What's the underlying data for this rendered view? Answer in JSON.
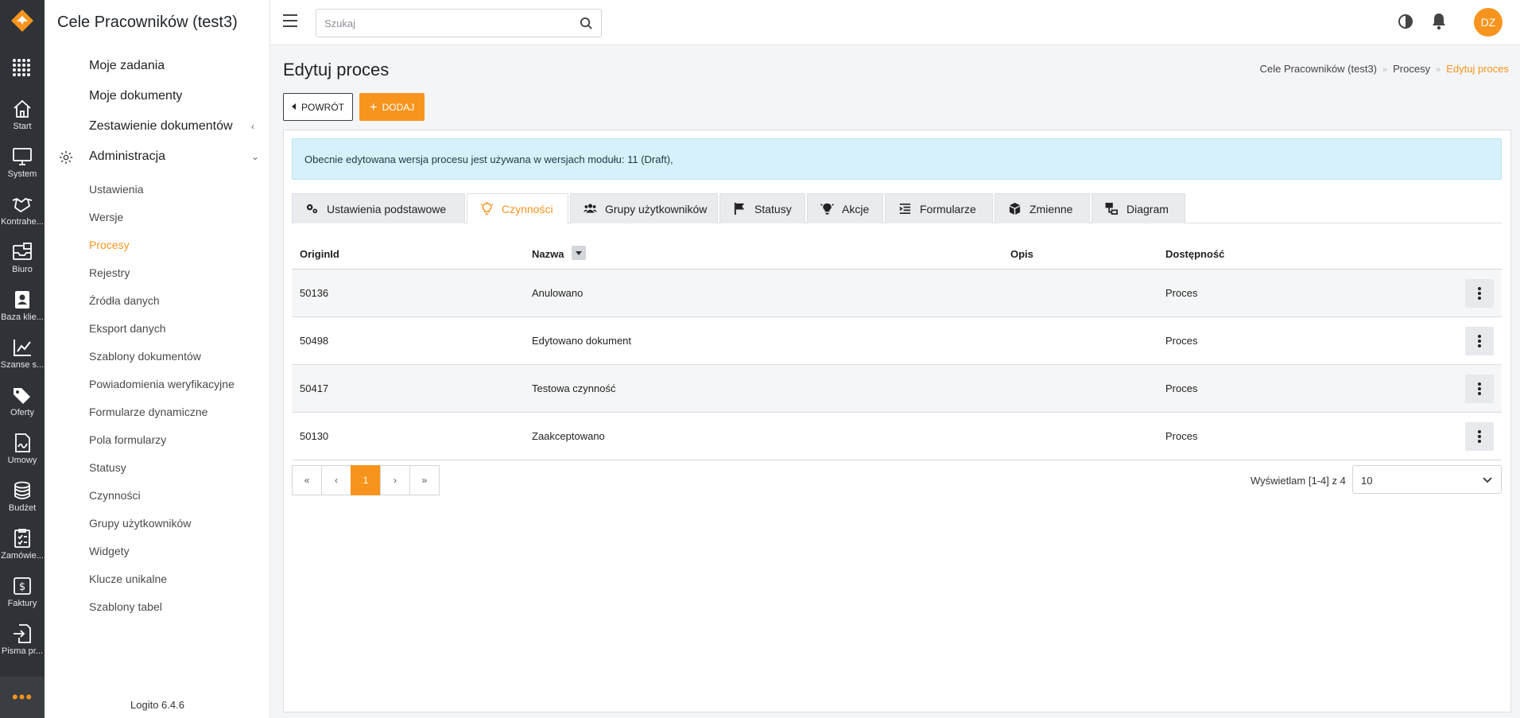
{
  "app": {
    "title": "Cele Pracowników (test3)",
    "version": "Logito 6.4.6",
    "user_initials": "DZ"
  },
  "colors": {
    "accent": "#f7941d",
    "rail": "#2f3237",
    "info_bg": "#d7f1fa"
  },
  "rail": [
    {
      "label": "Start",
      "icon": "home-icon"
    },
    {
      "label": "System",
      "icon": "monitor-icon"
    },
    {
      "label": "Kontrahe...",
      "icon": "handshake-icon"
    },
    {
      "label": "Biuro",
      "icon": "inbox-icon"
    },
    {
      "label": "Baza klie...",
      "icon": "contact-book-icon"
    },
    {
      "label": "Szanse s...",
      "icon": "line-chart-icon"
    },
    {
      "label": "Oferty",
      "icon": "tags-icon"
    },
    {
      "label": "Umowy",
      "icon": "signed-document-icon"
    },
    {
      "label": "Budżet",
      "icon": "coins-icon"
    },
    {
      "label": "Zamówie...",
      "icon": "checklist-icon"
    },
    {
      "label": "Faktury",
      "icon": "invoice-icon"
    },
    {
      "label": "Pisma pr...",
      "icon": "incoming-letter-icon"
    }
  ],
  "sidebar": {
    "main": [
      {
        "label": "Moje zadania"
      },
      {
        "label": "Moje dokumenty"
      },
      {
        "label": "Zestawienie dokumentów",
        "chevron": "‹"
      },
      {
        "label": "Administracja",
        "chevron": "⌄"
      }
    ],
    "sub": [
      {
        "label": "Ustawienia"
      },
      {
        "label": "Wersje"
      },
      {
        "label": "Procesy"
      },
      {
        "label": "Rejestry"
      },
      {
        "label": "Źródła danych"
      },
      {
        "label": "Eksport danych"
      },
      {
        "label": "Szablony dokumentów"
      },
      {
        "label": "Powiadomienia weryfikacyjne"
      },
      {
        "label": "Formularze dynamiczne"
      },
      {
        "label": "Pola formularzy"
      },
      {
        "label": "Statusy"
      },
      {
        "label": "Czynności"
      },
      {
        "label": "Grupy użytkowników"
      },
      {
        "label": "Widgety"
      },
      {
        "label": "Klucze unikalne"
      },
      {
        "label": "Szablony tabel"
      }
    ],
    "active": "Procesy"
  },
  "topbar": {
    "search_placeholder": "Szukaj"
  },
  "page": {
    "title": "Edytuj proces",
    "breadcrumb": [
      "Cele Pracowników (test3)",
      "Procesy",
      "Edytuj proces"
    ],
    "back_label": "POWRÓT",
    "add_label": "DODAJ",
    "info": "Obecnie edytowana wersja procesu jest używana w wersjach modułu: 11 (Draft),"
  },
  "tabs": [
    {
      "label": "Ustawienia podstawowe",
      "icon": "gears-icon"
    },
    {
      "label": "Czynności",
      "icon": "lightbulb-icon",
      "active": true
    },
    {
      "label": "Grupy użytkowników",
      "icon": "users-icon"
    },
    {
      "label": "Statusy",
      "icon": "flag-icon"
    },
    {
      "label": "Akcje",
      "icon": "bulb-alert-icon"
    },
    {
      "label": "Formularze",
      "icon": "form-list-icon"
    },
    {
      "label": "Zmienne",
      "icon": "cube-icon"
    },
    {
      "label": "Diagram",
      "icon": "diagram-icon"
    }
  ],
  "table": {
    "columns": [
      "OriginId",
      "Nazwa",
      "Opis",
      "Dostępność"
    ],
    "rows": [
      {
        "origin": "50136",
        "name": "Anulowano",
        "desc": "",
        "avail": "Proces"
      },
      {
        "origin": "50498",
        "name": "Edytowano dokument",
        "desc": "",
        "avail": "Proces"
      },
      {
        "origin": "50417",
        "name": "Testowa czynność",
        "desc": "",
        "avail": "Proces"
      },
      {
        "origin": "50130",
        "name": "Zaakceptowano",
        "desc": "",
        "avail": "Proces"
      }
    ]
  },
  "pager": {
    "first": "«",
    "prev": "‹",
    "current": "1",
    "next": "›",
    "last": "»",
    "info": "Wyświetlam [1-4] z 4",
    "page_size": "10"
  }
}
